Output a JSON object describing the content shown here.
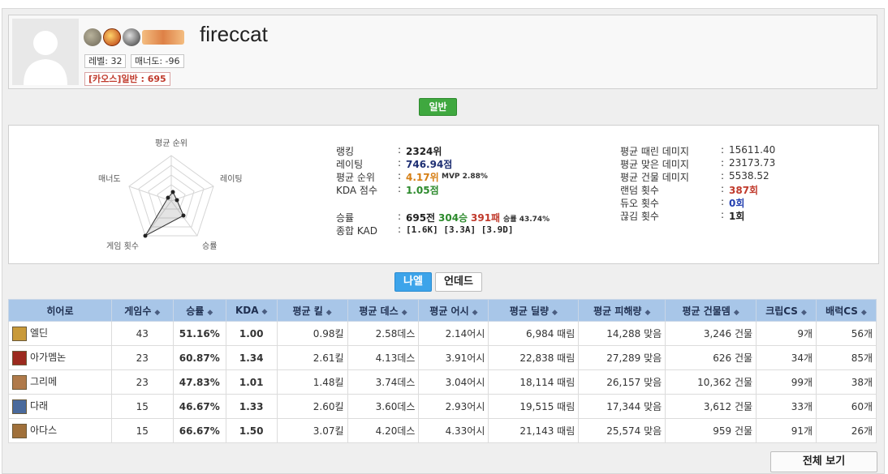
{
  "profile": {
    "nickname": "fireccat",
    "level": "레벨: 32",
    "manner": "매너도: -96",
    "chaos_rating": "[카오스]일반 : 695",
    "badges": [
      "rank-badge-icon",
      "vip-badge-icon",
      "sphere-badge-icon",
      "event-banner-icon"
    ]
  },
  "mode_button": "일반",
  "radar": {
    "labels": {
      "top": "평균 순위",
      "right": "레이팅",
      "bottom_right": "승률",
      "bottom_left": "게임 횟수",
      "left": "매너도"
    }
  },
  "stats_left": [
    {
      "label": "랭킹",
      "value": "2324위"
    },
    {
      "label": "레이팅",
      "value": "746.94점"
    },
    {
      "label": "평균 순위",
      "value": "4.17위",
      "extra": "MVP 2.88%"
    },
    {
      "label": "KDA 점수",
      "value": "1.05점"
    },
    {
      "label": "승률",
      "games": "695전",
      "wins": "304승",
      "losses": "391패",
      "rate": "승률 43.74%"
    },
    {
      "label": "종합 KAD",
      "value": "[1.6K] [3.3A] [3.9D]"
    }
  ],
  "stats_right": [
    {
      "label": "평균 때린 데미지",
      "value": "15611.40"
    },
    {
      "label": "평균 맞은 데미지",
      "value": "23173.73"
    },
    {
      "label": "평균 건물 데미지",
      "value": "5538.52"
    },
    {
      "label": "랜덤 횟수",
      "value": "387회"
    },
    {
      "label": "듀오 횟수",
      "value": "0회"
    },
    {
      "label": "끊김 횟수",
      "value": "1회"
    }
  ],
  "colon": ":",
  "tabs": [
    "나엘",
    "언데드"
  ],
  "table": {
    "headers": [
      "히어로",
      "게임수",
      "승률",
      "KDA",
      "평균 킬",
      "평균 데스",
      "평균 어시",
      "평균 딜량",
      "평균 피해량",
      "평균 건물뎀",
      "크립CS",
      "배럭CS"
    ],
    "rows": [
      {
        "hero": "엘딘",
        "games": "43",
        "rate": "51.16%",
        "kda": "1.00",
        "kill": "0.98킬",
        "death": "2.58데스",
        "assist": "2.14어시",
        "dmg": "6,984 때림",
        "taken": "14,288 맞음",
        "bld": "3,246 건물",
        "creep": "9개",
        "barrack": "56개",
        "color": "#c99a3a"
      },
      {
        "hero": "아가멤논",
        "games": "23",
        "rate": "60.87%",
        "kda": "1.34",
        "kill": "2.61킬",
        "death": "4.13데스",
        "assist": "3.91어시",
        "dmg": "22,838 때림",
        "taken": "27,289 맞음",
        "bld": "626 건물",
        "creep": "34개",
        "barrack": "85개",
        "color": "#9c2a1e"
      },
      {
        "hero": "그리메",
        "games": "23",
        "rate": "47.83%",
        "kda": "1.01",
        "kill": "1.48킬",
        "death": "3.74데스",
        "assist": "3.04어시",
        "dmg": "18,114 때림",
        "taken": "26,157 맞음",
        "bld": "10,362 건물",
        "creep": "99개",
        "barrack": "38개",
        "color": "#b07a4a"
      },
      {
        "hero": "다래",
        "games": "15",
        "rate": "46.67%",
        "kda": "1.33",
        "kill": "2.60킬",
        "death": "3.60데스",
        "assist": "2.93어시",
        "dmg": "19,515 때림",
        "taken": "17,344 맞음",
        "bld": "3,612 건물",
        "creep": "33개",
        "barrack": "60개",
        "color": "#4a6a9c"
      },
      {
        "hero": "아다스",
        "games": "15",
        "rate": "66.67%",
        "kda": "1.50",
        "kill": "3.07킬",
        "death": "4.20데스",
        "assist": "4.33어시",
        "dmg": "21,143 때림",
        "taken": "25,574 맞음",
        "bld": "959 건물",
        "creep": "91개",
        "barrack": "26개",
        "color": "#a0703a"
      }
    ]
  },
  "view_all": "전체 보기"
}
